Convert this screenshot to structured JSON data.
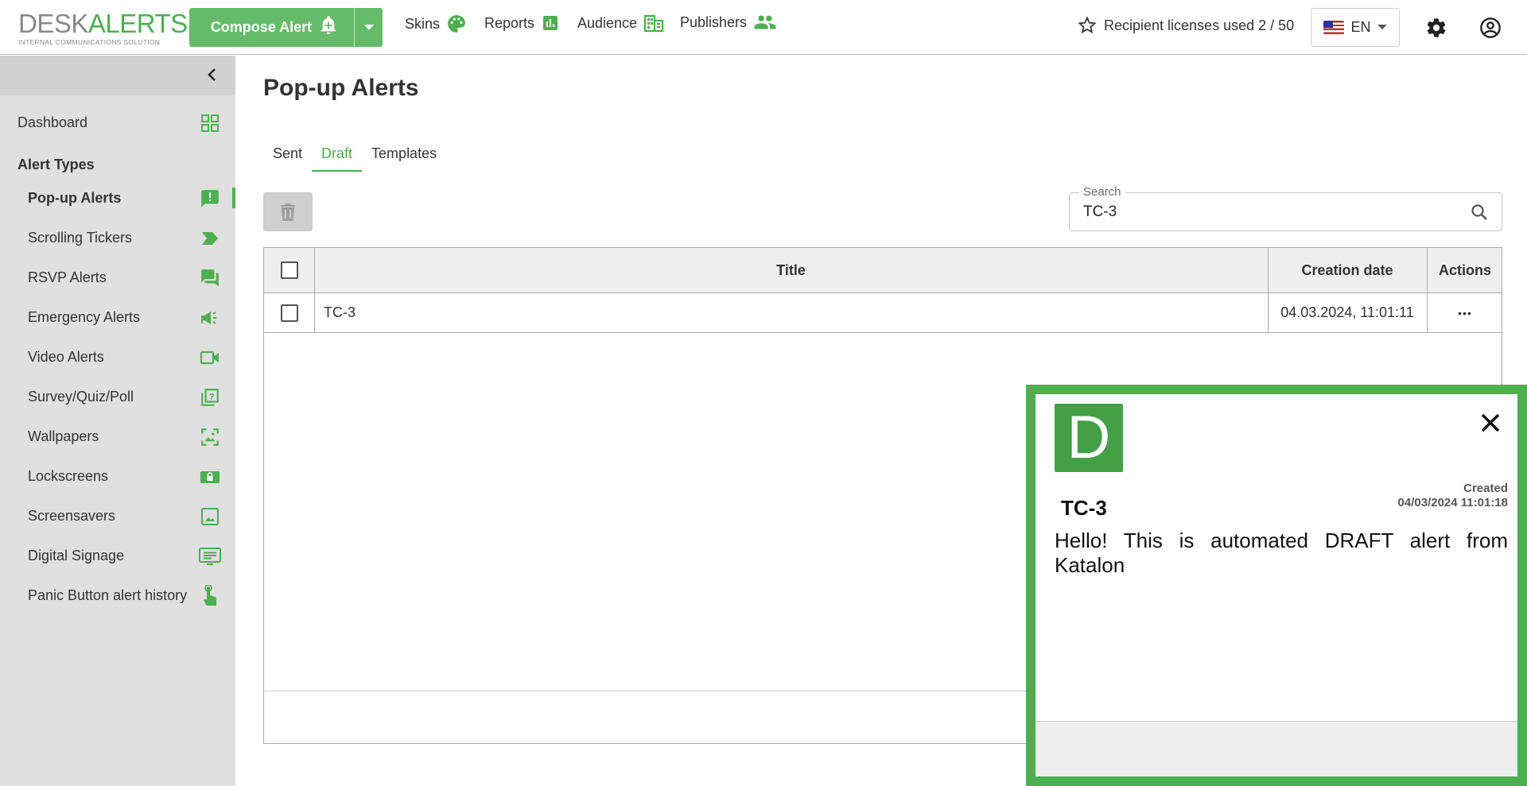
{
  "app": {
    "logo_desk": "DESK",
    "logo_alerts": "ALERTS",
    "logo_tagline": "INTERNAL COMMUNICATIONS SOLUTION"
  },
  "header": {
    "compose_label": "Compose Alert",
    "nav": [
      {
        "label": "Skins",
        "icon": "palette-icon"
      },
      {
        "label": "Reports",
        "icon": "bar-chart-icon"
      },
      {
        "label": "Audience",
        "icon": "building-icon"
      },
      {
        "label": "Publishers",
        "icon": "people-icon"
      }
    ],
    "licenses": "Recipient licenses used 2 / 50",
    "language": "EN",
    "accent": "#4caf50"
  },
  "sidebar": {
    "dashboard": "Dashboard",
    "section_title": "Alert Types",
    "items": [
      {
        "label": "Pop-up Alerts",
        "icon": "exclamation-chat-icon",
        "active": true
      },
      {
        "label": "Scrolling Tickers",
        "icon": "ticker-arrow-icon"
      },
      {
        "label": "RSVP Alerts",
        "icon": "chat-bubbles-icon"
      },
      {
        "label": "Emergency Alerts",
        "icon": "megaphone-icon"
      },
      {
        "label": "Video Alerts",
        "icon": "video-camera-icon"
      },
      {
        "label": "Survey/Quiz/Poll",
        "icon": "question-icon"
      },
      {
        "label": "Wallpapers",
        "icon": "wallpaper-icon"
      },
      {
        "label": "Lockscreens",
        "icon": "lock-icon"
      },
      {
        "label": "Screensavers",
        "icon": "image-icon"
      },
      {
        "label": "Digital Signage",
        "icon": "signage-icon"
      },
      {
        "label": "Panic Button alert history",
        "icon": "touch-icon"
      }
    ]
  },
  "main": {
    "title": "Pop-up Alerts",
    "tabs": [
      {
        "label": "Sent"
      },
      {
        "label": "Draft",
        "active": true
      },
      {
        "label": "Templates"
      }
    ],
    "search": {
      "label": "Search",
      "value": "TC-3"
    },
    "table": {
      "headers": {
        "title": "Title",
        "creation_date": "Creation date",
        "actions": "Actions"
      },
      "rows": [
        {
          "title": "TC-3",
          "creation_date": "04.03.2024, 11:01:11",
          "actions": "•••"
        }
      ]
    }
  },
  "popup": {
    "badge_letter": "D",
    "title": "TC-3",
    "created_label": "Created",
    "created_value": "04/03/2024 11:01:18",
    "body": "Hello! This is automated DRAFT alert from Katalon",
    "border_color": "#4caf50"
  }
}
